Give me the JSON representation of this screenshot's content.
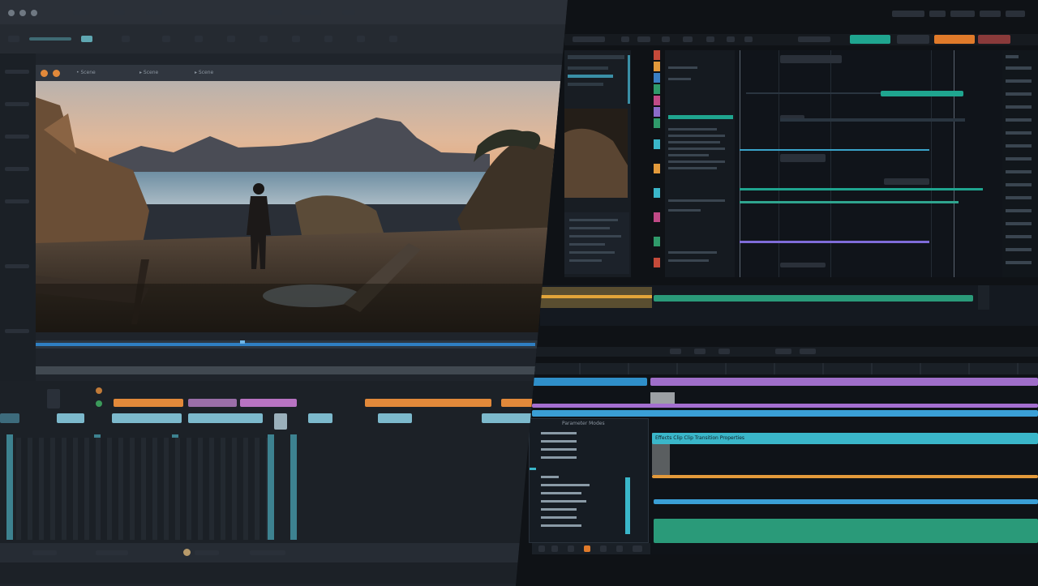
{
  "preview_window": {
    "tabs": [
      {
        "label": "Scene"
      },
      {
        "label": "Scene"
      },
      {
        "label": "Scene"
      }
    ]
  },
  "top_right_buttons": [
    "",
    "",
    "",
    "",
    ""
  ],
  "track_header": {
    "label": "Parameter Modes"
  },
  "clip_label": "Effects Clip Clip Transition Properties",
  "colors": {
    "teal": "#1fa58f",
    "orange": "#e07a2a",
    "purple": "#8b6cc9",
    "cyan": "#3ab6c9",
    "green": "#2a9a79",
    "amber": "#e39a3b",
    "blue": "#2f7fc2",
    "red": "#c44a3a"
  },
  "icons": [
    "close-icon",
    "minimize-icon",
    "play-icon",
    "lock-icon",
    "settings-icon"
  ]
}
